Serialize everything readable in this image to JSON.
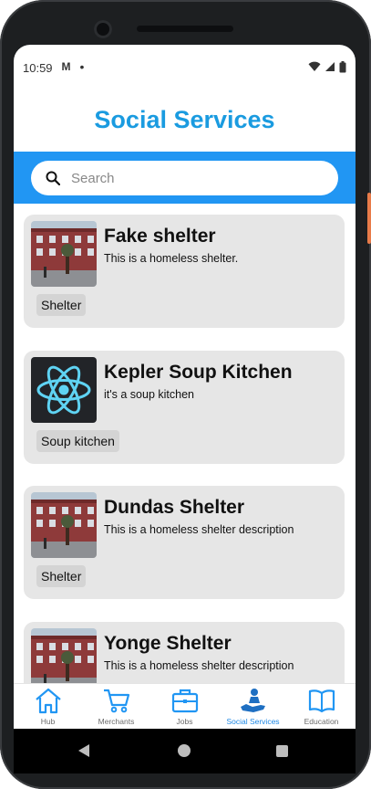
{
  "status_bar": {
    "time": "10:59",
    "notification_icon": "gmail-icon",
    "dot": "•",
    "icons": [
      "wifi-icon",
      "signal-icon",
      "battery-icon"
    ]
  },
  "page": {
    "title": "Social Services",
    "title_color": "#1a9be0",
    "accent_color": "#2196f3"
  },
  "search": {
    "placeholder": "Search",
    "icon": "search-icon"
  },
  "cards": [
    {
      "name": "Fake shelter",
      "description": "This is a homeless shelter.",
      "tag": "Shelter",
      "image": "building-photo"
    },
    {
      "name": "Kepler Soup Kitchen",
      "description": "it's a soup kitchen",
      "tag": "Soup kitchen",
      "image": "react-logo-icon"
    },
    {
      "name": "Dundas Shelter",
      "description": "This is a homeless shelter description",
      "tag": "Shelter",
      "image": "building-photo"
    },
    {
      "name": "Yonge Shelter",
      "description": "This is a homeless shelter description",
      "tag": "",
      "image": "building-photo"
    }
  ],
  "bottom_nav": {
    "items": [
      {
        "label": "Hub",
        "icon": "home-icon"
      },
      {
        "label": "Merchants",
        "icon": "cart-icon"
      },
      {
        "label": "Jobs",
        "icon": "briefcase-icon"
      },
      {
        "label": "Social Services",
        "icon": "helping-hand-icon",
        "active": true
      },
      {
        "label": "Education",
        "icon": "book-icon"
      }
    ]
  }
}
